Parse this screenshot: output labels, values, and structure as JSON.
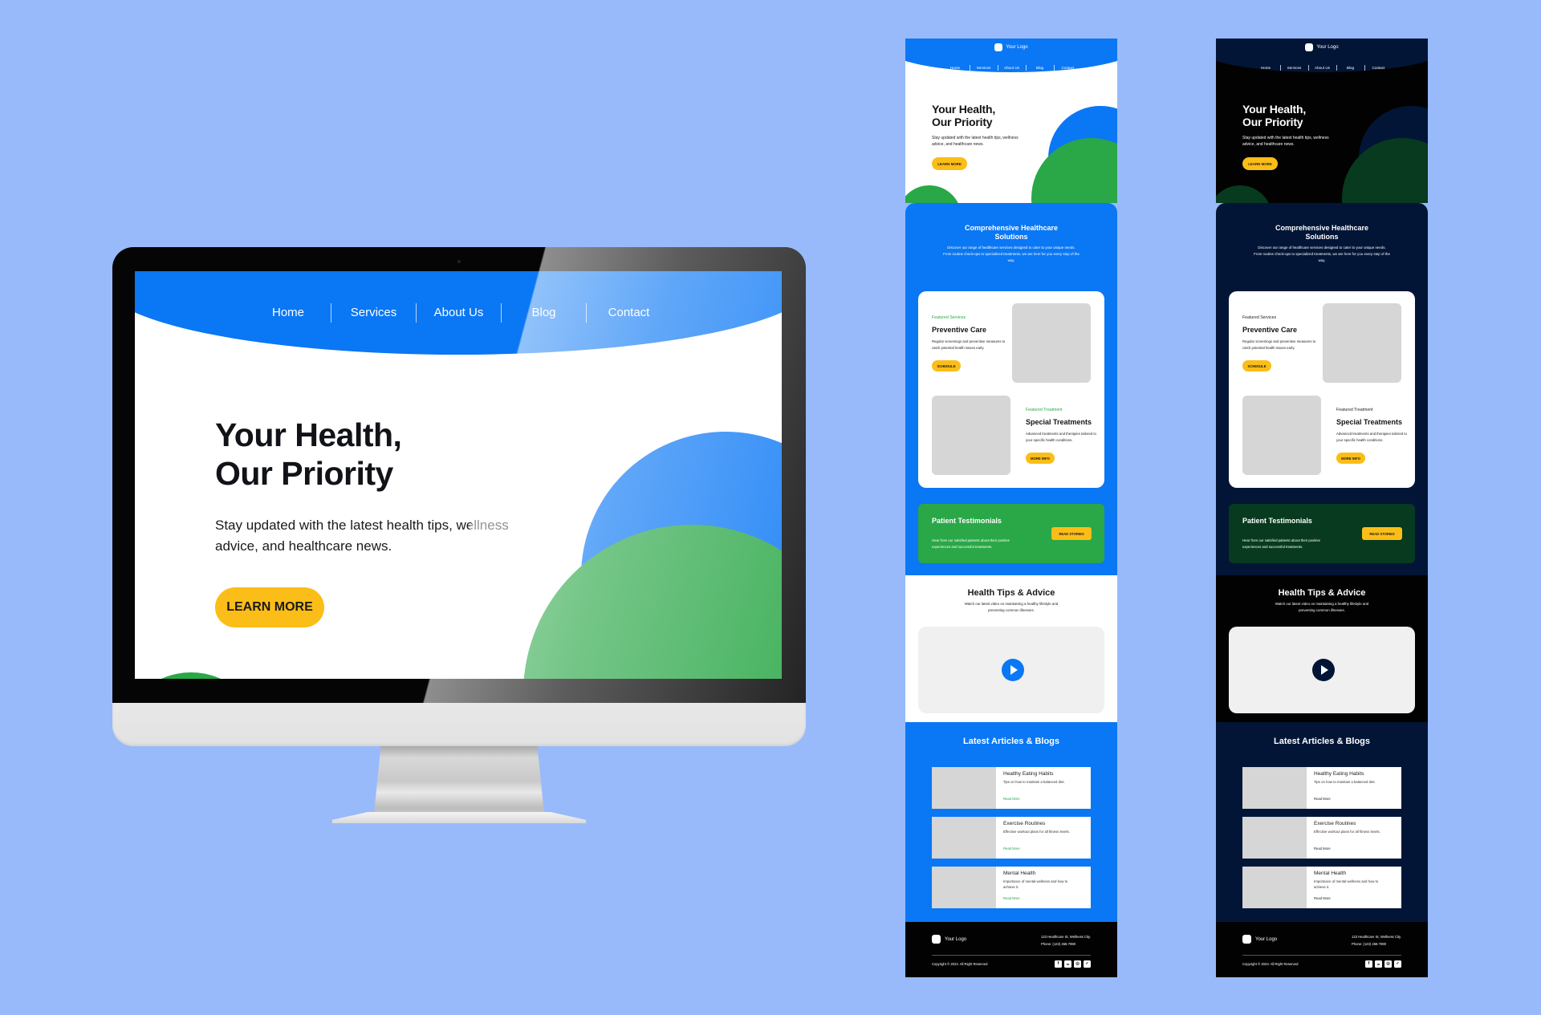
{
  "theme": {
    "background": "#98bafb",
    "blue": "#0a77f5",
    "green": "#2aa747",
    "yellow": "#fbbd17",
    "navy": "#021536",
    "dark_green": "#073a1e",
    "black": "#020202"
  },
  "desktop": {
    "nav": [
      "Home",
      "Services",
      "About Us",
      "Blog",
      "Contact"
    ],
    "hero": {
      "title": "Your Health,\nOur Priority",
      "subtitle": "Stay updated with the latest health tips, wellness advice, and healthcare news.",
      "button": "LEARN MORE"
    }
  },
  "mobile": {
    "logo": "Your Logo",
    "nav": [
      "Home",
      "Services",
      "About Us",
      "Blog",
      "Contact"
    ],
    "hero": {
      "title": "Your Health,\nOur Priority",
      "subtitle": "Stay updated with the latest health tips, wellness advice, and healthcare news.",
      "button": "LEARN MORE"
    },
    "services": {
      "title": "Comprehensive Healthcare\nSolutions",
      "description": "Discover our range of healthcare services designed to cater to your unique needs. From routine check-ups to specialized treatments, we are here for you every step of the way.",
      "featured": [
        {
          "label": "Featured Services",
          "title": "Preventive Care",
          "description": "Regular screenings and preventive measures to catch potential health issues early.",
          "button": "SCHEDULE"
        },
        {
          "label": "Featured Treatment",
          "title": "Special Treatments",
          "description": "Advanced treatments and therapies tailored to your specific health conditions.",
          "button": "MORE INFO"
        }
      ]
    },
    "testimonials": {
      "title": "Patient Testimonials",
      "description": "Hear from our satisfied patients about their positive experiences and successful treatments.",
      "button": "READ STORIES"
    },
    "tips": {
      "title": "Health Tips & Advice",
      "description": "Watch our latest video on maintaining a healthy lifestyle and preventing common illnesses.",
      "video_icon": "play-icon"
    },
    "blogs": {
      "title": "Latest Articles & Blogs",
      "items": [
        {
          "title": "Healthy Eating Habits",
          "description": "Tips on how to maintain a balanced diet.",
          "link": "Read More"
        },
        {
          "title": "Exercise Routines",
          "description": "Effective workout plans for all fitness levels.",
          "link": "Read More"
        },
        {
          "title": "Mental Health",
          "description": "Importance of mental wellness and how to achieve it.",
          "link": "Read More"
        }
      ]
    },
    "footer": {
      "logo": "Your Logo",
      "address": "123 Healthcare St, Wellness City.\nPhone: (123) 456-7890",
      "copyright": "Copyright © 2023. All Right Reserved",
      "socials": [
        {
          "name": "facebook-icon",
          "glyph": "f"
        },
        {
          "name": "linkedin-icon",
          "glyph": "in"
        },
        {
          "name": "instagram-icon",
          "glyph": "◎"
        },
        {
          "name": "twitter-icon",
          "glyph": "✓"
        }
      ]
    }
  }
}
